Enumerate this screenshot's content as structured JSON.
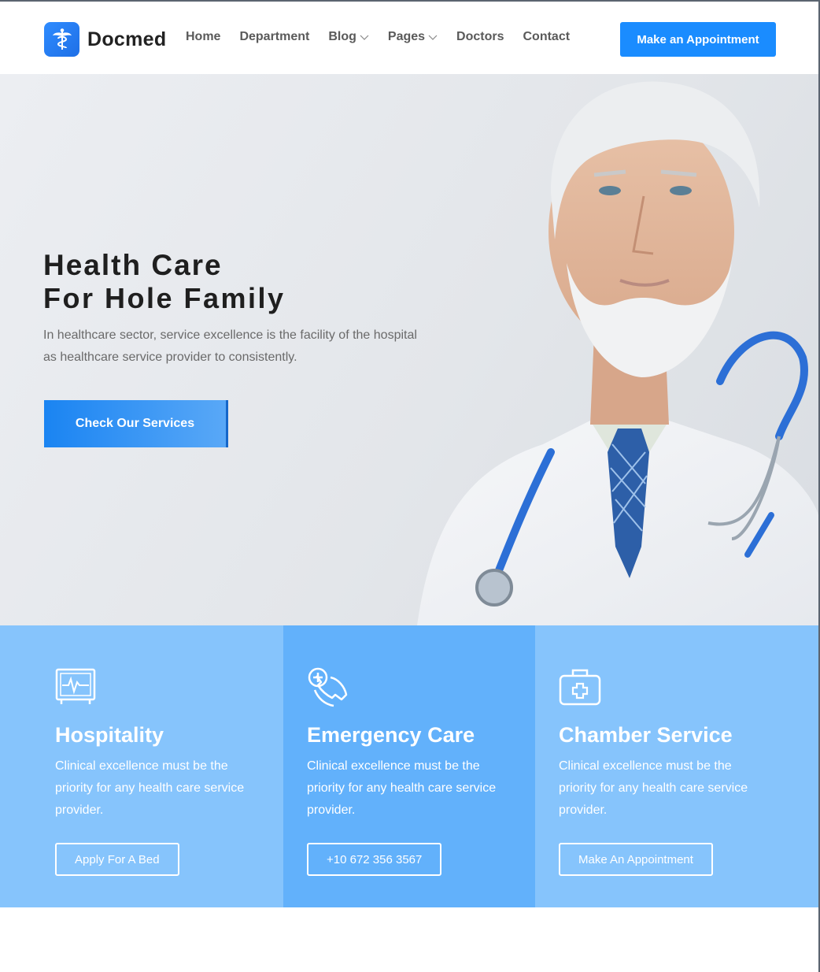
{
  "brand": {
    "name": "Docmed",
    "logo_icon": "caduceus-icon",
    "accent": "#1a8cff"
  },
  "nav": {
    "items": [
      {
        "label": "Home",
        "dropdown": false
      },
      {
        "label": "Department",
        "dropdown": false
      },
      {
        "label": "Blog",
        "dropdown": true
      },
      {
        "label": "Pages",
        "dropdown": true
      },
      {
        "label": "Doctors",
        "dropdown": false
      },
      {
        "label": "Contact",
        "dropdown": false
      }
    ],
    "cta": "Make an Appointment"
  },
  "hero": {
    "title": "Health Care",
    "subtitle": "For Hole Family",
    "description": "In healthcare sector, service excellence is the facility of the hospital as healthcare service provider to consistently.",
    "button": "Check Our Services"
  },
  "services": [
    {
      "icon": "heart-monitor-icon",
      "title": "Hospitality",
      "text": "Clinical excellence must be the priority for any health care service provider.",
      "button": "Apply For A Bed",
      "bg": "#86c4fc"
    },
    {
      "icon": "emergency-phone-icon",
      "title": "Emergency Care",
      "text": "Clinical excellence must be the priority for any health care service provider.",
      "button": "+10 672 356 3567",
      "bg": "#62b1fb"
    },
    {
      "icon": "first-aid-kit-icon",
      "title": "Chamber Service",
      "text": "Clinical excellence must be the priority for any health care service provider.",
      "button": "Make An Appointment",
      "bg": "#86c4fc"
    }
  ]
}
